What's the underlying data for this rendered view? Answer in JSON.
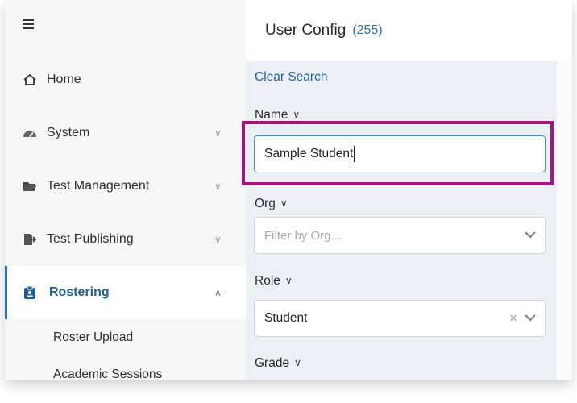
{
  "header": {
    "title": "User Config",
    "count": "(255)"
  },
  "sidebar": {
    "items": [
      {
        "label": "Home",
        "icon": "home-icon"
      },
      {
        "label": "System",
        "icon": "gauge-icon"
      },
      {
        "label": "Test Management",
        "icon": "folder-icon"
      },
      {
        "label": "Test Publishing",
        "icon": "publish-icon"
      },
      {
        "label": "Rostering",
        "icon": "badge-icon",
        "active": true
      }
    ],
    "sub_items": [
      "Roster Upload",
      "Academic Sessions"
    ]
  },
  "filters": {
    "clear_search": "Clear Search",
    "name_label": "Name",
    "name_value": "Sample Student",
    "org_label": "Org",
    "org_placeholder": "Filter by Org...",
    "role_label": "Role",
    "role_value": "Student",
    "grade_label": "Grade"
  },
  "colors": {
    "accent": "#1f5f99",
    "highlight": "#a8137a",
    "panel_bg": "#eceff3",
    "sidebar_bg": "#f6f6f6"
  }
}
